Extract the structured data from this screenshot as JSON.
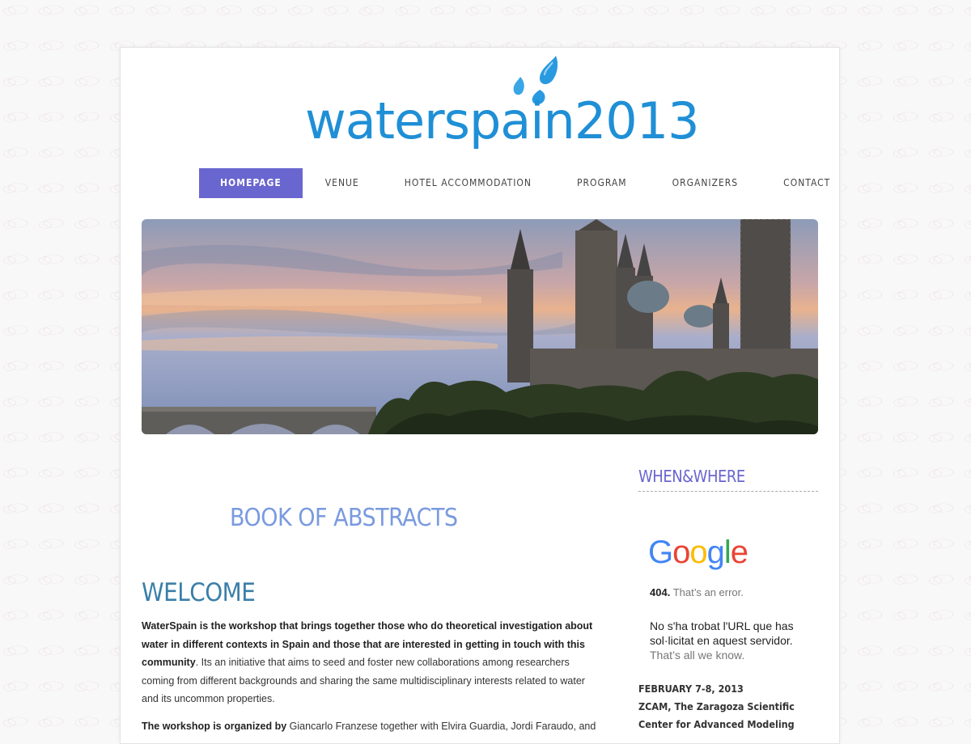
{
  "logo": {
    "text": "waterspain2013",
    "brand_color": "#1f8fd6"
  },
  "nav": {
    "items": [
      {
        "label": "HOMEPAGE",
        "active": true
      },
      {
        "label": "VENUE",
        "active": false
      },
      {
        "label": "HOTEL ACCOMMODATION",
        "active": false
      },
      {
        "label": "PROGRAM",
        "active": false
      },
      {
        "label": "ORGANIZERS",
        "active": false
      },
      {
        "label": "CONTACT",
        "active": false
      }
    ],
    "active_color": "#6a66cf"
  },
  "banner": {
    "subject": "zaragoza-basilica-photo"
  },
  "main": {
    "book_link": "BOOK OF ABSTRACTS",
    "welcome_title": "WELCOME",
    "para1_bold": "WaterSpain is the workshop that brings together those who do theoretical investigation about water in different contexts in Spain and those that are interested in getting in touch with this community",
    "para1_rest": ". Its an initiative that aims to seed and foster new collaborations among researchers coming from different backgrounds and sharing the same multidisciplinary interests related to water and its uncommon properties.",
    "para2_bold": "The workshop is organized by",
    "para2_rest": " Giancarlo Franzese together with Elvira Guardia, Jordi Faraudo, and"
  },
  "sidebar": {
    "title": "WHEN&WHERE",
    "google_logo": "Google",
    "error_code": "404.",
    "error_text": " That’s an error.",
    "error_msg": "No s'ha trobat l'URL que has sol·licitat en aquest servidor.",
    "error_note": "That’s all we know.",
    "date": "FEBRUARY 7-8, 2013",
    "venue_line1": "ZCAM, The Zaragoza Scientific",
    "venue_line2": "Center for Advanced Modeling"
  }
}
